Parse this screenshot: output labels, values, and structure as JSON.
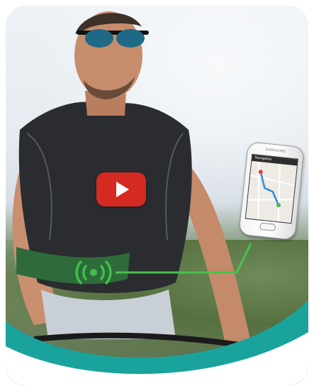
{
  "video": {
    "play_icon": "play-icon",
    "accent_color": "#d42a21"
  },
  "phone": {
    "brand": "SAMSUNG",
    "app_title": "Navigation",
    "map_icon": "map-route-icon"
  },
  "belt": {
    "signal_icon": "vibration-signal-icon",
    "accent_color": "#3fbf4a"
  },
  "colors": {
    "teal": "#1aa39c",
    "belt_green": "#2f6b3a",
    "connector_green": "#49c24c"
  }
}
